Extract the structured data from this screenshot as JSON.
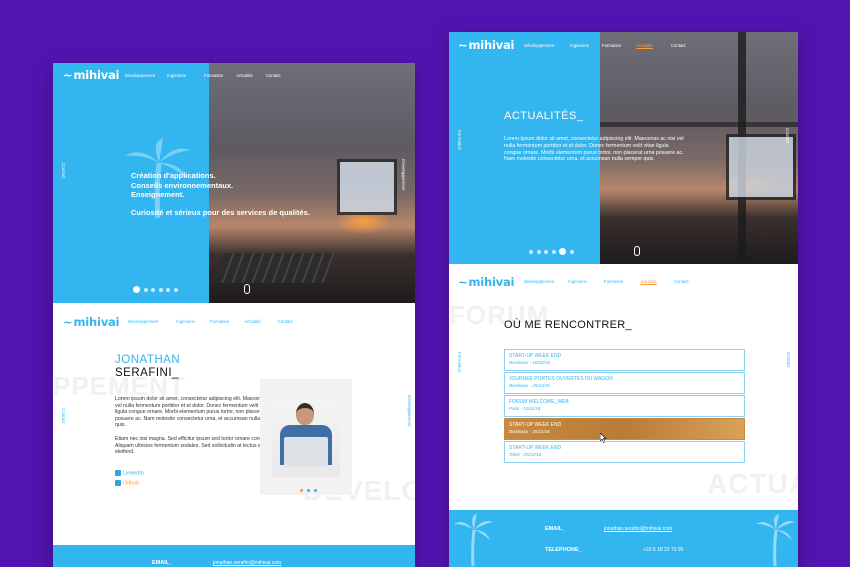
{
  "colors": {
    "background": "#5214b0",
    "accent": "#33b5f0",
    "active": "#ff9a3c"
  },
  "brand": "mihivai",
  "nav": [
    "Développement",
    "Ingénierie",
    "Formation",
    "Actualité",
    "Contact"
  ],
  "left": {
    "hero": {
      "line1": "Création d'applications.",
      "line2": "Conseils environnementaux.",
      "line3": "Enseignement.",
      "tagline": "Curiosité et sérieux pour des services de qualités.",
      "side_contact": "Contact",
      "side_dev": "Développement"
    },
    "about": {
      "first_name": "JONATHAN",
      "last_name": "SERAFINI_",
      "para1": "Lorem ipsum dolor sit amet, consectetur adipiscing elit. Maecenas ac nisi vel nulla fermentum porttitor et et dolor. Donec fermentum velit vitae ligula congue ornare. Morbi elementum purus tortor, non placerat urna posuere ac. Nam molestie consectetur urna, et accumsan nulla semper quis.",
      "para2": "Etiam nec nisi magna. Sed efficitur ipsum sed tortor ornare congue. Aliquam ultricies fermentum sodales. Sed sollicitudin at lectus eu eleifend.",
      "linkedin": "LinkedIn",
      "github": "Github",
      "side_contact": "Contact",
      "side_dev": "Développement",
      "bg_word_left": "PPEMENT",
      "bg_word_bottom": "DEVELO"
    },
    "footer": {
      "email_label": "EMAIL_",
      "email_value": "jonathan.serafini@mihivai.com"
    }
  },
  "right": {
    "hero": {
      "title": "ACTUALITÉS_",
      "text": "Lorem ipsum dolor sit amet, consectetur adipiscing elit. Maecenas ac nisi vel nulla fermentum porttitor et et dolor. Donec fermentum velit vitae ligula congue ornare. Morbi elementum purus tortor, non placerat urna posuere ac. Nam molestie consectetur urna, et accumsan nulla semper quis.",
      "side_formation": "Formation",
      "side_contact": "Contact"
    },
    "meet": {
      "title": "OÙ ME RENCONTRER_",
      "bg_word_top": "FORUM",
      "bg_word_bottom": "ACTUA",
      "side_formation": "Formation",
      "side_contact": "Contact",
      "items": [
        {
          "title": "START-UP WEEK END",
          "sub": "Bordeaux - 16/02/18"
        },
        {
          "title": "JOURNÉE PORTES OUVERTES DU WAGON",
          "sub": "Bordeaux - 25/10/18"
        },
        {
          "title": "FORUM WELCOME_WEB",
          "sub": "Paris - 10/11/18"
        },
        {
          "title": "START-UP WEEK END",
          "sub": "Bordeaux - 25/11/18"
        },
        {
          "title": "START-UP WEEK END",
          "sub": "Tahiti - 25/12/18"
        }
      ]
    },
    "footer": {
      "email_label": "EMAIL_",
      "email_value": "jonathan.serafini@mihivai.com",
      "phone_label": "TELEPHONE_",
      "phone_value": "+33 6 18 23 73 95"
    }
  }
}
